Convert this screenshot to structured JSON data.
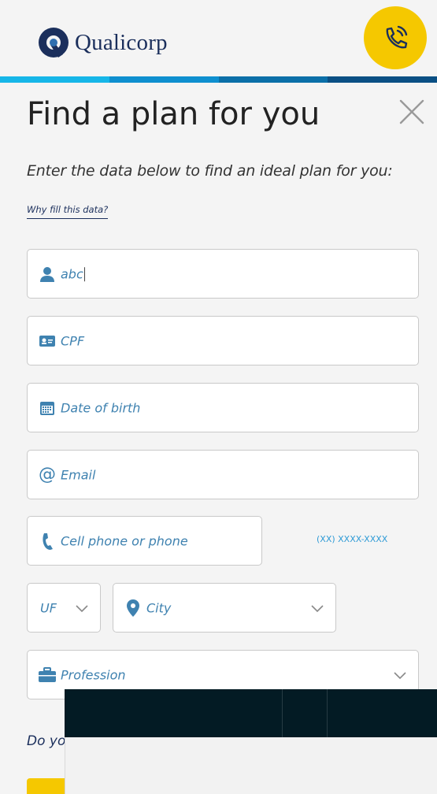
{
  "header": {
    "brand": "Qualicorp",
    "call_icon": "phone-ringing-icon",
    "stripe_colors": [
      "#16b6e8",
      "#0e8fcf",
      "#0b6fa8",
      "#0a4f84"
    ]
  },
  "form": {
    "title": "Find a plan for you",
    "close_icon": "close-icon",
    "subtitle": "Enter the data below to find an ideal plan for you:",
    "why_link": "Why fill this data?",
    "name": {
      "value": "abc",
      "icon": "user-icon"
    },
    "cpf": {
      "placeholder": "CPF",
      "icon": "id-card-icon"
    },
    "dob": {
      "placeholder": "Date of birth",
      "icon": "calendar-icon"
    },
    "email": {
      "placeholder": "Email",
      "icon": "at-icon"
    },
    "phone": {
      "placeholder": "Cell phone or phone",
      "icon": "phone-icon",
      "hint": "(XX) XXXX-XXXX"
    },
    "uf": {
      "placeholder": "UF"
    },
    "city": {
      "placeholder": "City",
      "icon": "map-pin-icon"
    },
    "profession": {
      "placeholder": "Profession",
      "icon": "briefcase-icon"
    },
    "question_partial": "Do yo"
  },
  "colors": {
    "accent_yellow": "#f5c800",
    "brand_navy": "#1b2f5c",
    "field_text": "#3f82b0",
    "overlay_dark": "#031b24"
  }
}
